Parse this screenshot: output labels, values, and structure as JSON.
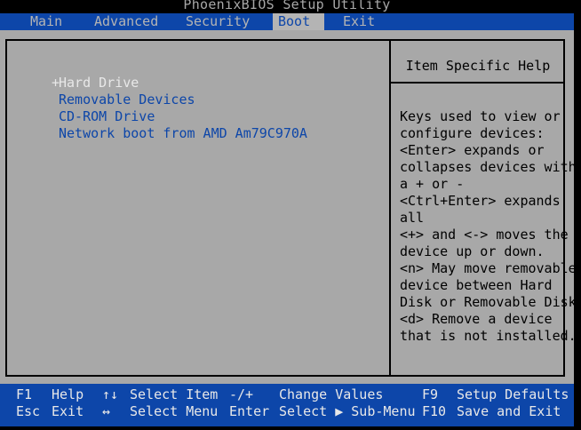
{
  "title": "PhoenixBIOS Setup Utility",
  "menu": [
    {
      "label": "Main"
    },
    {
      "label": "Advanced"
    },
    {
      "label": "Security"
    },
    {
      "label": "Boot"
    },
    {
      "label": "Exit"
    }
  ],
  "boot_devices": [
    {
      "marker": "+",
      "label": "Hard Drive"
    },
    {
      "label": "Removable Devices"
    },
    {
      "label": "CD-ROM Drive"
    },
    {
      "label": "Network boot from AMD Am79C970A"
    }
  ],
  "help": {
    "title": "Item Specific Help",
    "text": "Keys used to view or\nconfigure devices:\n<Enter> expands or\ncollapses devices with\na + or -\n<Ctrl+Enter> expands\nall\n<+> and <-> moves the\ndevice up or down.\n<n> May move removable\ndevice between Hard\nDisk or Removable Disk\n<d> Remove a device\nthat is not installed."
  },
  "status": {
    "row1": [
      {
        "key": "F1",
        "desc": "Help"
      },
      {
        "key": "↑↓",
        "desc": "Select Item"
      },
      {
        "key": "-/+",
        "desc": "Change Values"
      },
      {
        "key": "F9",
        "desc": "Setup Defaults"
      }
    ],
    "row2": [
      {
        "key": "Esc",
        "desc": "Exit"
      },
      {
        "key": "↔",
        "desc": "Select Menu"
      },
      {
        "key": "Enter",
        "desc": "Select ▶ Sub-Menu"
      },
      {
        "key": "F10",
        "desc": "Save and Exit"
      }
    ]
  },
  "colors": {
    "background": "#000000",
    "menu_bar": "#0d46a9",
    "panel": "#a8a8a8",
    "highlight_text": "#e8e8e8",
    "item_text": "#0d46a9"
  }
}
